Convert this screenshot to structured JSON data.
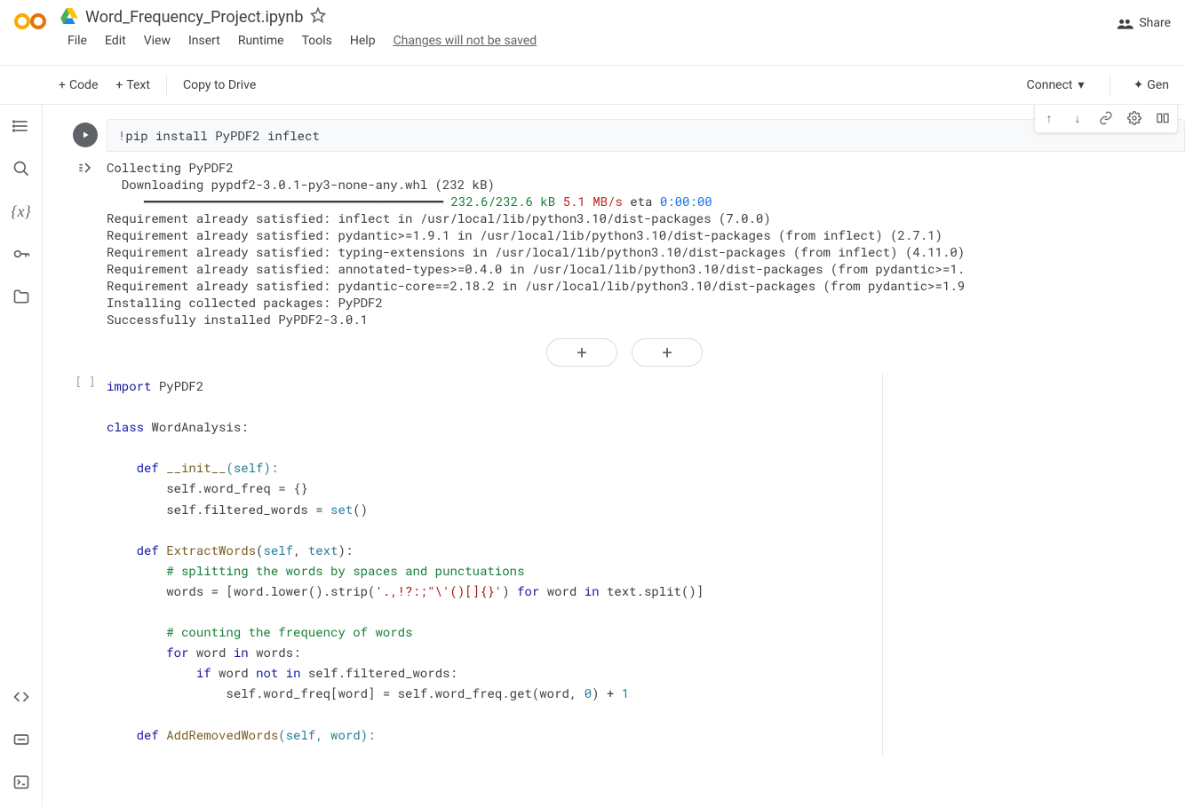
{
  "doc": {
    "title": "Word_Frequency_Project.ipynb",
    "save_note": "Changes will not be saved"
  },
  "menus": [
    "File",
    "Edit",
    "View",
    "Insert",
    "Runtime",
    "Tools",
    "Help"
  ],
  "share_label": "Share",
  "toolbar": {
    "code": "Code",
    "text": "Text",
    "copy": "Copy to Drive",
    "connect": "Connect",
    "gen": "Gen"
  },
  "cell1": {
    "input_prefix": "!",
    "input_cmd": "pip install PyPDF2 inflect",
    "output": {
      "l1": "Collecting PyPDF2",
      "l2": "  Downloading pypdf2-3.0.1-py3-none-any.whl (232 kB)",
      "bar": "     ━━━━━━━━━━━━━━━━━━━━━━━━━━━━━━━━━━━━━━━━",
      "size": " 232.6/232.6 kB",
      "speed": " 5.1 MB/s",
      "eta_label": " eta ",
      "eta": "0:00:00",
      "l3": "Requirement already satisfied: inflect in /usr/local/lib/python3.10/dist-packages (7.0.0)",
      "l4": "Requirement already satisfied: pydantic>=1.9.1 in /usr/local/lib/python3.10/dist-packages (from inflect) (2.7.1)",
      "l5": "Requirement already satisfied: typing-extensions in /usr/local/lib/python3.10/dist-packages (from inflect) (4.11.0)",
      "l6": "Requirement already satisfied: annotated-types>=0.4.0 in /usr/local/lib/python3.10/dist-packages (from pydantic>=1.",
      "l7": "Requirement already satisfied: pydantic-core==2.18.2 in /usr/local/lib/python3.10/dist-packages (from pydantic>=1.9",
      "l8": "Installing collected packages: PyPDF2",
      "l9": "Successfully installed PyPDF2-3.0.1"
    }
  },
  "cell2": {
    "prompt": "[ ]",
    "code": {
      "import_kw": "import",
      "module": " PyPDF2",
      "class_kw": "class",
      "class_name": " WordAnalysis:",
      "def_kw": "def",
      "init_name": " __init__",
      "init_params": "(self):",
      "init_l1": "        self.word_freq = {}",
      "init_l2a": "        self.filtered_words = ",
      "init_l2b": "set",
      "init_l2c": "()",
      "m2_name": " ExtractWords",
      "m2_params_open": "(",
      "m2_p1": "self",
      "m2_sep": ", ",
      "m2_p2": "text",
      "m2_params_close": "):",
      "c1": "# splitting the words by spaces and punctuations",
      "l1a": "        words = [word.lower().strip(",
      "l1b": "'.,!?:;\"\\'()[]{}'",
      "l1c": ") ",
      "l1d": "for",
      "l1e": " word ",
      "l1f": "in",
      "l1g": " text.split()]",
      "c2": "# counting the frequency of words",
      "l2a": "for",
      "l2b": " word ",
      "l2c": "in",
      "l2d": " words:",
      "l3a": "if",
      "l3b": " word ",
      "l3c": "not in",
      "l3d": " self.filtered_words:",
      "l4a": "                self.word_freq[word] = self.word_freq.get(word, ",
      "l4b": "0",
      "l4c": ") + ",
      "l4d": "1",
      "m3_name": " AddRemovedWords",
      "m3_params": "(self, word):"
    }
  }
}
